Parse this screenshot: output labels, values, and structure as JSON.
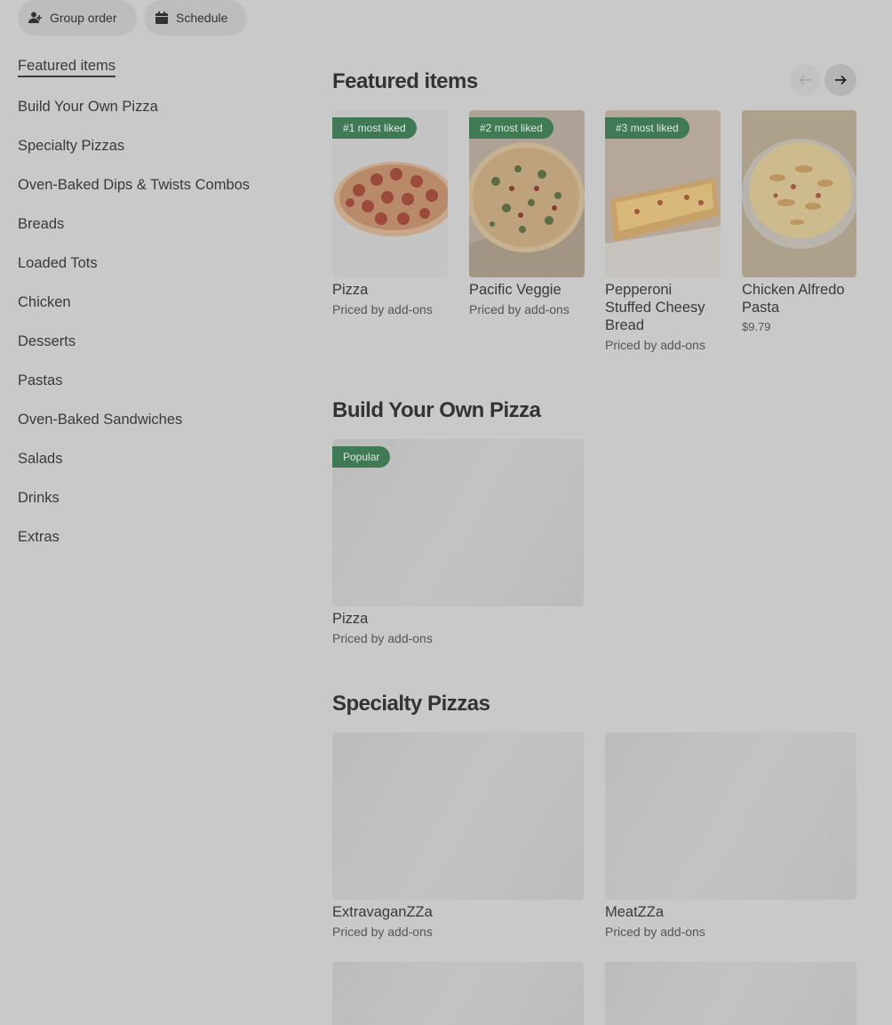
{
  "top_actions": {
    "group_order": "Group order",
    "schedule": "Schedule"
  },
  "sidebar": {
    "items": [
      {
        "label": "Featured items"
      },
      {
        "label": "Build Your Own Pizza"
      },
      {
        "label": "Specialty Pizzas"
      },
      {
        "label": "Oven-Baked Dips & Twists Combos"
      },
      {
        "label": "Breads"
      },
      {
        "label": "Loaded Tots"
      },
      {
        "label": "Chicken"
      },
      {
        "label": "Desserts"
      },
      {
        "label": "Pastas"
      },
      {
        "label": "Oven-Baked Sandwiches"
      },
      {
        "label": "Salads"
      },
      {
        "label": "Drinks"
      },
      {
        "label": "Extras"
      }
    ]
  },
  "featured": {
    "title": "Featured items",
    "items": [
      {
        "badge": "#1 most liked",
        "name": "Pizza",
        "price": "Priced by add-ons"
      },
      {
        "badge": "#2 most liked",
        "name": "Pacific Veggie",
        "price": "Priced by add-ons"
      },
      {
        "badge": "#3 most liked",
        "name": "Pepperoni Stuffed Cheesy Bread",
        "price": "Priced by add-ons"
      },
      {
        "badge": "",
        "name": "Chicken Alfredo Pasta",
        "price": "$9.79"
      }
    ]
  },
  "build": {
    "title": "Build Your Own Pizza",
    "items": [
      {
        "badge": "Popular",
        "name": "Pizza",
        "price": "Priced by add-ons"
      }
    ]
  },
  "specialty": {
    "title": "Specialty Pizzas",
    "items": [
      {
        "name": "ExtravaganZZa",
        "price": "Priced by add-ons"
      },
      {
        "name": "MeatZZa",
        "price": "Priced by add-ons"
      }
    ]
  },
  "colors": {
    "badge_green": "#3f7a55",
    "overlay_gray": "#c9c9c9"
  }
}
